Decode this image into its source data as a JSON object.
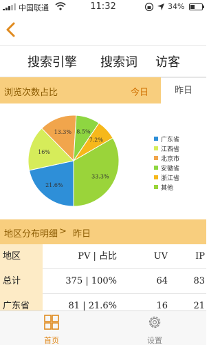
{
  "status_bar": {
    "carrier": "中国联通",
    "time": "11:32",
    "battery_text": "34%",
    "battery_level": 0.34
  },
  "tabs": [
    {
      "label": "搜索引擎"
    },
    {
      "label": "搜索词"
    },
    {
      "label": "访客"
    }
  ],
  "visits_section": {
    "title": "浏览次数占比",
    "range_today": "今日",
    "range_yesterday": "昨日"
  },
  "chart_data": {
    "type": "pie",
    "categories": [
      "广东省",
      "江西省",
      "北京市",
      "安徽省",
      "浙江省",
      "其他"
    ],
    "values": [
      21.6,
      16,
      13.3,
      8.5,
      7.2,
      33.3
    ],
    "labels": [
      "21.6%",
      "16%",
      "13.3%",
      "8.5%",
      "7.2%",
      "33.3%"
    ],
    "colors": [
      "#2e8fd8",
      "#d6ec5a",
      "#f1a54c",
      "#8ed641",
      "#f6b81b",
      "#9ad43a"
    ],
    "legend": "right"
  },
  "region_section": {
    "title": "地区分布明细",
    "chevron": ">",
    "date": "昨日"
  },
  "table": {
    "headers": [
      "地区",
      "PV | 占比",
      "UV",
      "IP"
    ],
    "rows": [
      [
        "总计",
        "375 | 100%",
        "64",
        "83"
      ],
      [
        "广东省",
        "81 | 21.6%",
        "16",
        "21"
      ]
    ]
  },
  "bottom_bar": {
    "home_label": "首页",
    "settings_label": "设置"
  },
  "colors": {
    "accent": "#e08a1e",
    "section_bg": "#f8ce7e",
    "first_col_bg": "#fdebc6"
  }
}
